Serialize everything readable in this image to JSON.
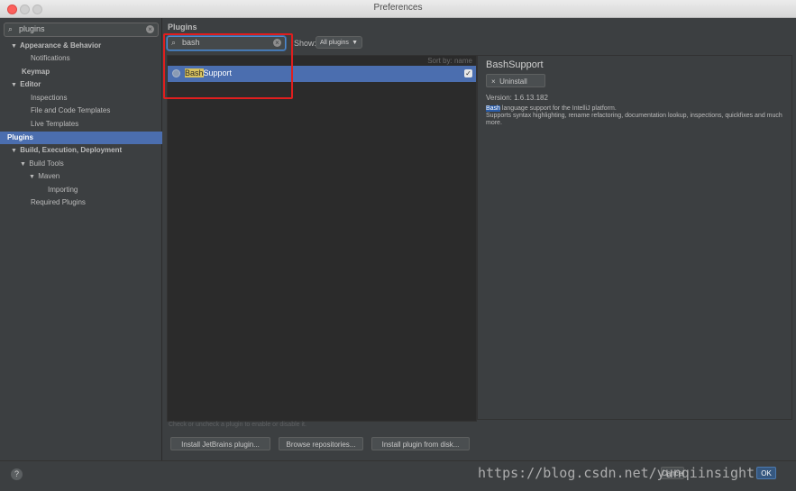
{
  "window": {
    "title": "Preferences"
  },
  "sidebar": {
    "search": {
      "value": "plugins"
    },
    "items": [
      {
        "label": "Appearance & Behavior",
        "expanded": true
      },
      {
        "label": "Notifications"
      },
      {
        "label": "Keymap"
      },
      {
        "label": "Editor",
        "expanded": true
      },
      {
        "label": "Inspections"
      },
      {
        "label": "File and Code Templates"
      },
      {
        "label": "Live Templates"
      },
      {
        "label": "Plugins",
        "selected": true
      },
      {
        "label": "Build, Execution, Deployment",
        "expanded": true
      },
      {
        "label": "Build Tools",
        "expanded": true
      },
      {
        "label": "Maven",
        "expanded": true
      },
      {
        "label": "Importing"
      },
      {
        "label": "Required Plugins"
      }
    ]
  },
  "plugins": {
    "title": "Plugins",
    "search": {
      "value": "bash"
    },
    "show_label": "Show:",
    "show_select": "All plugins",
    "sort_by": "Sort by: name",
    "list": [
      {
        "name_highlight": "Bash",
        "name_rest": "Support",
        "enabled": true,
        "selected": true
      }
    ],
    "detail": {
      "name": "BashSupport",
      "uninstall_label": "Uninstall",
      "version": "Version: 1.6.13.182",
      "desc_highlight": "Bash",
      "desc_line1": " language support for the IntelliJ platform.",
      "desc_line2": "Supports syntax highlighting, rename refactoring, documentation lookup, inspections, quickfixes and much more."
    },
    "hint": "Check or uncheck a plugin to enable or disable it.",
    "buttons": {
      "install_jb": "Install JetBrains plugin...",
      "browse": "Browse repositories...",
      "install_disk": "Install plugin from disk..."
    }
  },
  "footer": {
    "help": "?",
    "cancel": "Cancel",
    "ok": "OK",
    "watermark": "https://blog.csdn.net/yunqiinsight"
  },
  "colors": {
    "selection": "#4b6eaf",
    "annotation_box": "#e01e1e",
    "search_highlight": "#d7c15e"
  }
}
